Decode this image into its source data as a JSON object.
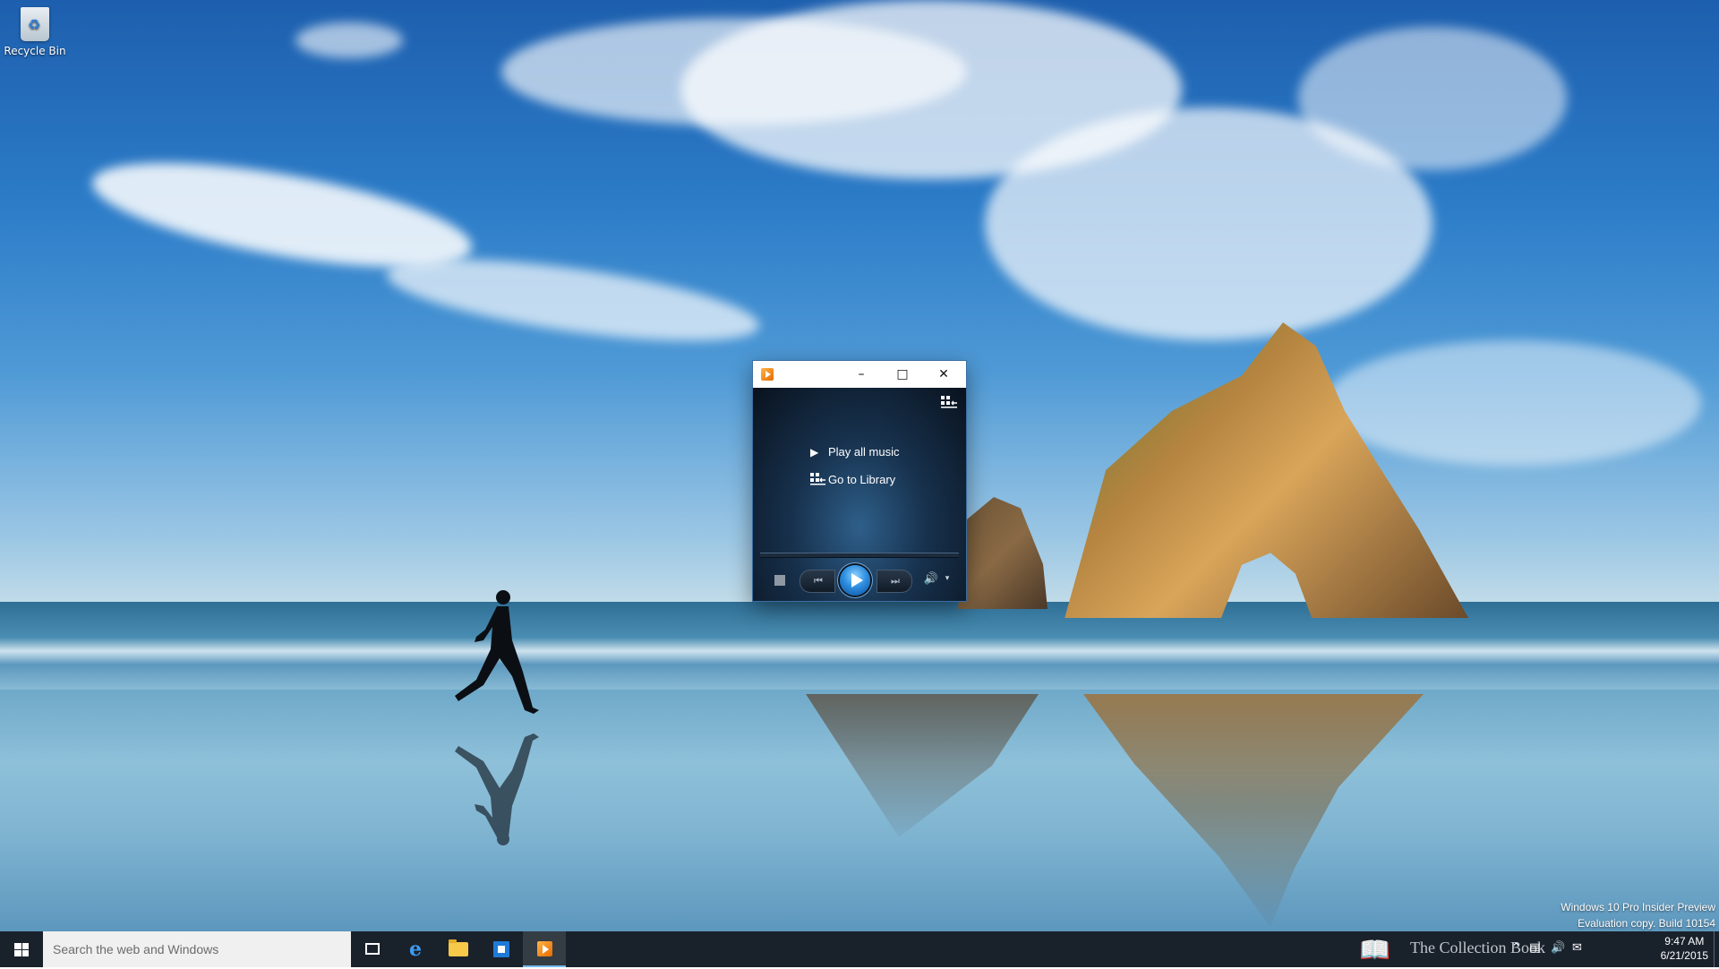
{
  "desktop": {
    "icons": [
      {
        "label": "Recycle Bin",
        "icon": "recycle-bin-icon"
      }
    ],
    "watermark": {
      "line1": "Windows 10 Pro Insider Preview",
      "line2": "Evaluation copy. Build 10154"
    }
  },
  "wmp": {
    "window_title": "",
    "controls": {
      "minimize": "–",
      "maximize": "□",
      "close": "✕"
    },
    "switch_to_library_icon": "switch-to-library-icon",
    "links": [
      {
        "label": "Play all music",
        "icon": "play-icon"
      },
      {
        "label": "Go to Library",
        "icon": "library-icon"
      }
    ],
    "progress": 0,
    "transport": {
      "stop": "stop-icon",
      "previous": "⏮",
      "play": "play-icon",
      "next": "⏭",
      "volume": "volume-icon",
      "volume_menu": "▾"
    }
  },
  "taskbar": {
    "search_placeholder": "Search the web and Windows",
    "pinned": [
      "task-view-icon",
      "edge-icon",
      "file-explorer-icon",
      "store-icon",
      "windows-media-player-icon"
    ],
    "overlay_text": "The Collection Book",
    "tray_icons": [
      "chevron-up-icon",
      "network-icon",
      "volume-icon",
      "action-center-icon"
    ],
    "clock": {
      "time": "9:47 AM",
      "date": "6/21/2015"
    }
  },
  "colors": {
    "taskbar_bg": "#101822",
    "accent": "#76b9ed",
    "wmp_play": "#2f8fe0"
  }
}
